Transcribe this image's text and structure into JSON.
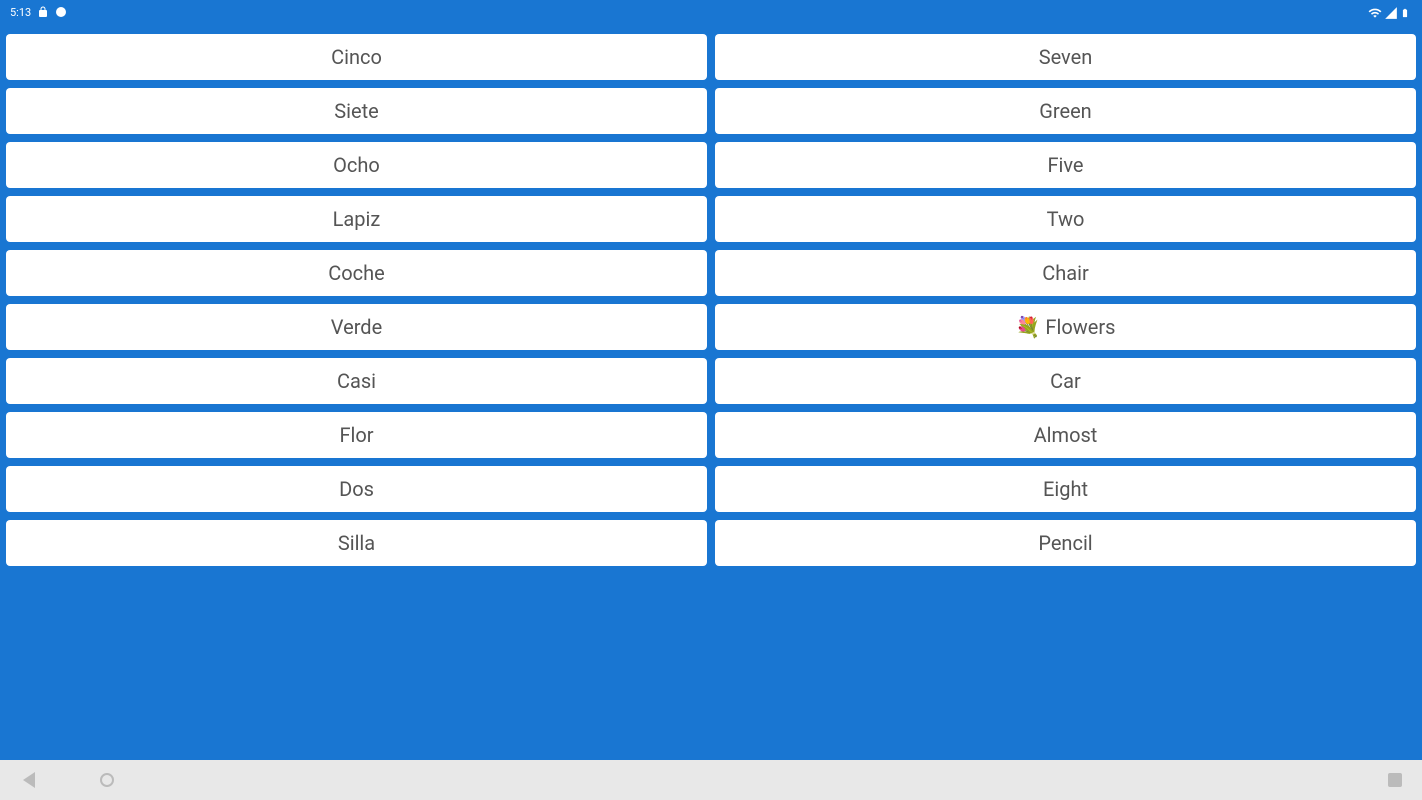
{
  "status_bar": {
    "time": "5:13",
    "icons_left": [
      "lock-icon",
      "unknown-icon"
    ],
    "icons_right": [
      "wifi-icon",
      "signal-icon",
      "battery-icon"
    ]
  },
  "left_column": [
    "Cinco",
    "Siete",
    "Ocho",
    "Lapiz",
    "Coche",
    "Verde",
    "Casi",
    "Flor",
    "Dos",
    "Silla"
  ],
  "right_column": [
    "Seven",
    "Green",
    "Five",
    "Two",
    "Chair",
    "💐 Flowers",
    "Car",
    "Almost",
    "Eight",
    "Pencil"
  ],
  "colors": {
    "background": "#1976D2",
    "card_bg": "#FFFFFF",
    "card_text": "#555555",
    "nav_bg": "#E8E8E8",
    "nav_icon": "#BBBBBB"
  }
}
